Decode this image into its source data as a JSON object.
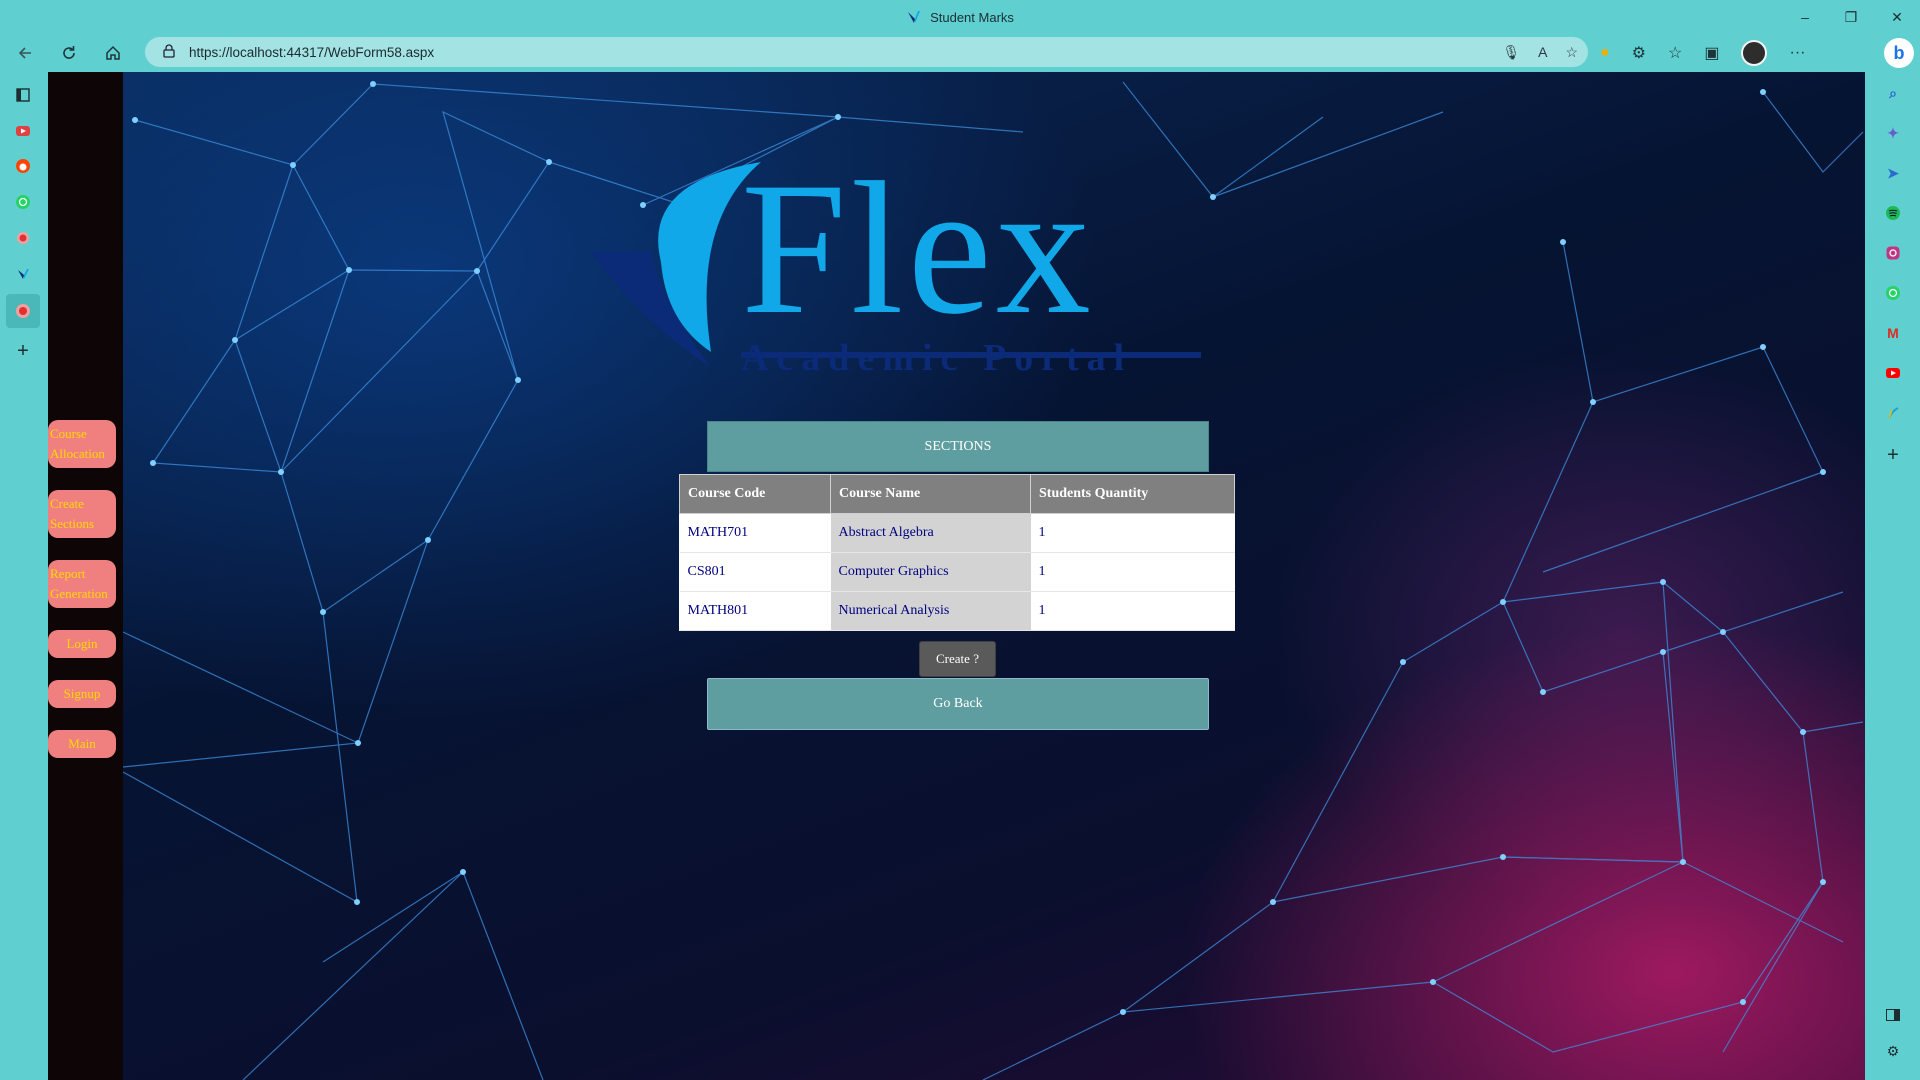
{
  "browser": {
    "tab_title": "Student Marks",
    "url": "https://localhost:44317/WebForm58.aspx",
    "window_controls": {
      "minimize": "–",
      "restore": "❐",
      "close": "✕"
    },
    "nav_icons": [
      "back-arrow-icon",
      "refresh-icon",
      "home-icon"
    ],
    "address_icons": [
      "microphone-icon",
      "read-aloud-icon",
      "add-favorite-icon"
    ],
    "toolbar_icons": [
      "extension-icon",
      "puzzle-icon",
      "favorites-icon",
      "collections-icon",
      "profile-avatar",
      "more-icon"
    ],
    "more_label": "···",
    "bing_label": "b"
  },
  "left_tabs": [
    {
      "icon": "sidebar-toggle-icon",
      "color": "#1d2d30"
    },
    {
      "icon": "youtube-tab-icon",
      "color": "#e04040"
    },
    {
      "icon": "reddit-tab-icon",
      "color": "#ff4500"
    },
    {
      "icon": "whatsapp-tab-icon",
      "color": "#25d366"
    },
    {
      "icon": "record-tab-icon",
      "color": "#e03030"
    },
    {
      "icon": "flex-tab-icon",
      "color": "#1060c0"
    },
    {
      "icon": "active-record-tab-icon",
      "color": "#e03030"
    },
    {
      "icon": "new-tab-plus-icon",
      "color": "#1d2d30"
    }
  ],
  "right_sidebar": [
    {
      "icon": "search-icon",
      "color": "#2a6bd0"
    },
    {
      "icon": "copilot-icon",
      "color": "#6a5bd0"
    },
    {
      "icon": "send-icon",
      "color": "#2a6bd0"
    },
    {
      "icon": "spotify-icon",
      "color": "#1db954"
    },
    {
      "icon": "instagram-icon",
      "color": "#c13584"
    },
    {
      "icon": "whatsapp-icon",
      "color": "#25d366"
    },
    {
      "icon": "gmail-icon",
      "color": "#d93025"
    },
    {
      "icon": "youtube-icon",
      "color": "#ff0000"
    },
    {
      "icon": "flex-icon",
      "color": "#16a3d8"
    },
    {
      "icon": "add-icon",
      "color": "#1d2d30"
    },
    {
      "icon": "split-screen-icon",
      "color": "#1d2d30"
    },
    {
      "icon": "settings-icon",
      "color": "#1d2d30"
    }
  ],
  "side_nav": [
    {
      "label": "Course Allocation"
    },
    {
      "label": "Create Sections"
    },
    {
      "label": "Report Generation"
    },
    {
      "label": "Login"
    },
    {
      "label": "Signup"
    },
    {
      "label": "Main"
    }
  ],
  "logo": {
    "word": "Flex",
    "subtitle": "Academic Portal",
    "color": "#10a8e8"
  },
  "page": {
    "sections_label": "SECTIONS",
    "table": {
      "headers": [
        "Course Code",
        "Course Name",
        "Students Quantity"
      ],
      "rows": [
        [
          "MATH701",
          "Abstract Algebra",
          "1"
        ],
        [
          "CS801",
          "Computer Graphics",
          "1"
        ],
        [
          "MATH801",
          "Numerical Analysis",
          "1"
        ]
      ]
    },
    "create_label": "Create ?",
    "go_back_label": "Go Back"
  },
  "colors": {
    "accent": "#5f9ea0",
    "nav_button_bg": "#f08080",
    "nav_button_text": "#ffd700",
    "header_bg": "#808080",
    "cell_text": "#000080"
  }
}
